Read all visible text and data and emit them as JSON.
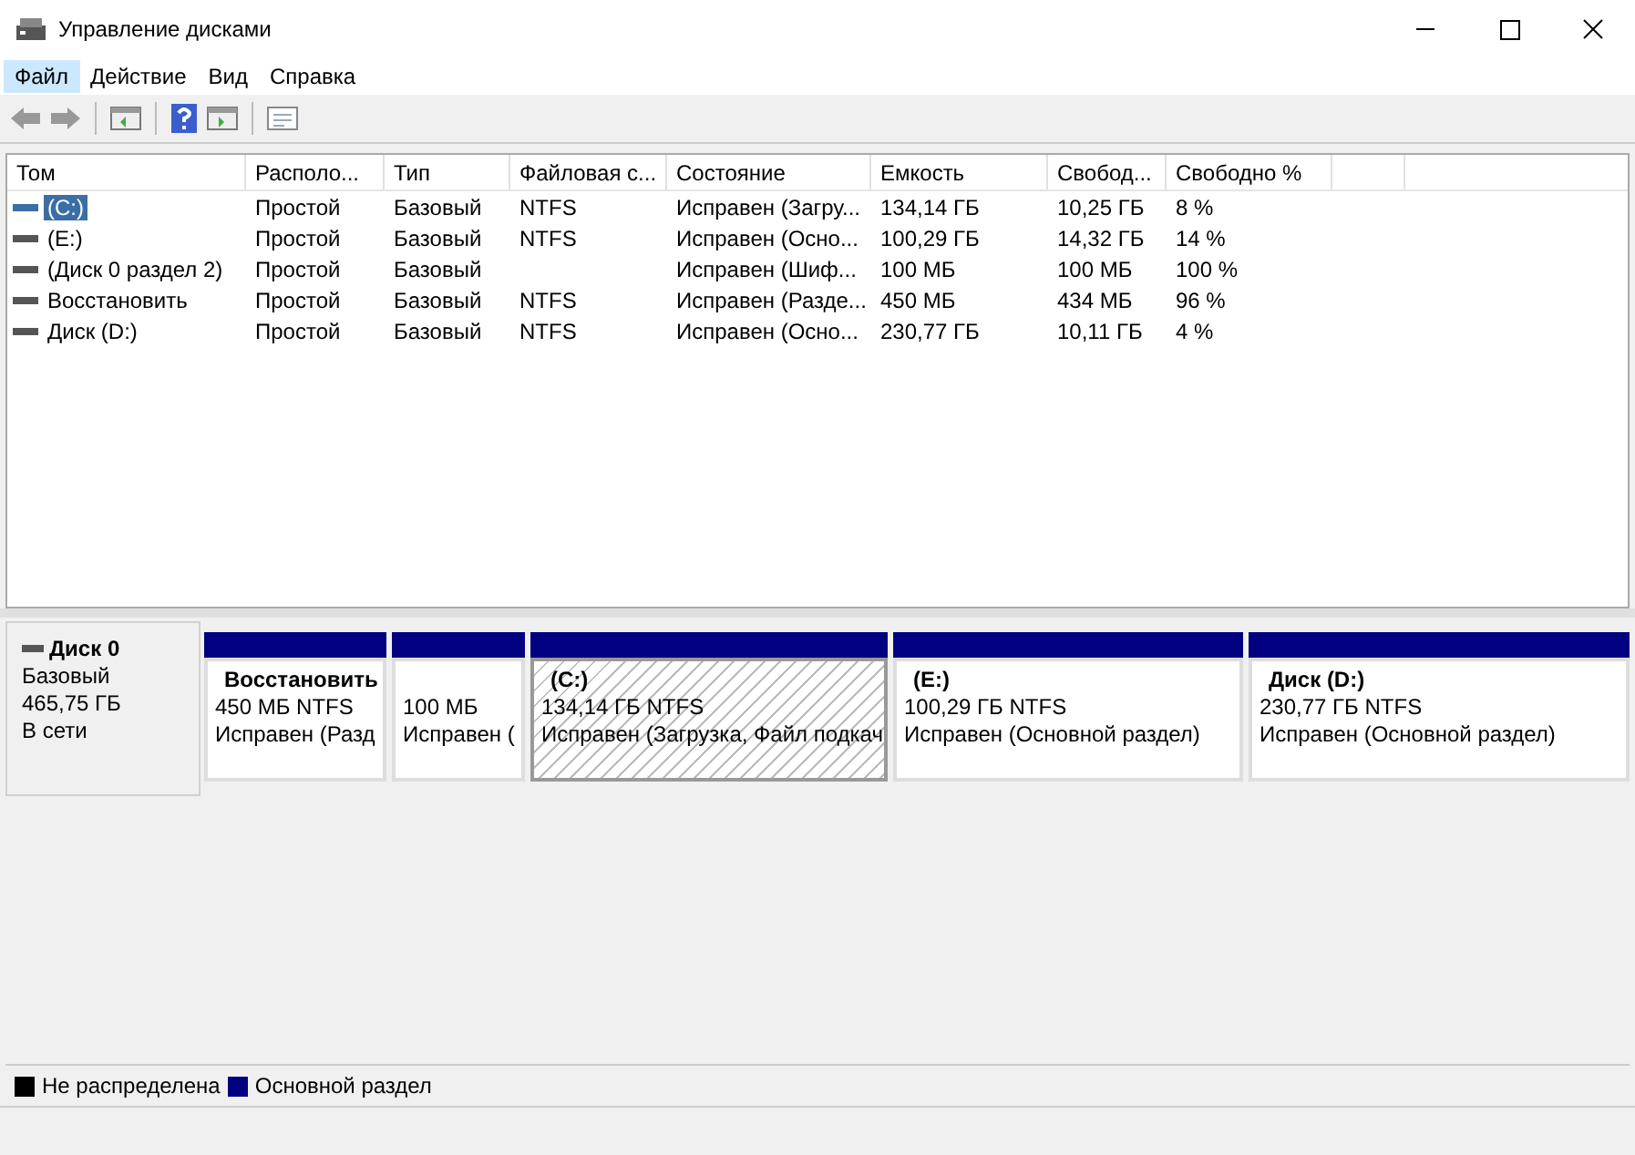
{
  "window": {
    "title": "Управление дисками"
  },
  "menu": [
    {
      "label": "Файл",
      "selected": true
    },
    {
      "label": "Действие",
      "selected": false
    },
    {
      "label": "Вид",
      "selected": false
    },
    {
      "label": "Справка",
      "selected": false
    }
  ],
  "table": {
    "columns": [
      "Том",
      "Располо...",
      "Тип",
      "Файловая с...",
      "Состояние",
      "Емкость",
      "Свобод...",
      "Свободно %"
    ],
    "rows": [
      {
        "selected": true,
        "cells": [
          "(C:)",
          "Простой",
          "Базовый",
          "NTFS",
          "Исправен (Загру...",
          "134,14 ГБ",
          "10,25 ГБ",
          "8 %"
        ]
      },
      {
        "selected": false,
        "cells": [
          " (E:)",
          "Простой",
          "Базовый",
          "NTFS",
          "Исправен (Осно...",
          "100,29 ГБ",
          "14,32 ГБ",
          "14 %"
        ]
      },
      {
        "selected": false,
        "cells": [
          "(Диск 0 раздел 2)",
          "Простой",
          "Базовый",
          "",
          "Исправен (Шиф...",
          "100 МБ",
          "100 МБ",
          "100 %"
        ]
      },
      {
        "selected": false,
        "cells": [
          "Восстановить",
          "Простой",
          "Базовый",
          "NTFS",
          "Исправен (Разде...",
          "450 МБ",
          "434 МБ",
          "96 %"
        ]
      },
      {
        "selected": false,
        "cells": [
          "Диск (D:)",
          "Простой",
          "Базовый",
          "NTFS",
          "Исправен (Осно...",
          "230,77 ГБ",
          "10,11 ГБ",
          "4 %"
        ]
      }
    ]
  },
  "disk": {
    "name": "Диск 0",
    "type": "Базовый",
    "size": "465,75 ГБ",
    "status": "В сети",
    "partitions": [
      {
        "selected": false,
        "label": "Восстановить",
        "size": "450 МБ NTFS",
        "status": "Исправен (Разд"
      },
      {
        "selected": false,
        "size": "100 МБ",
        "status": "Исправен ("
      },
      {
        "selected": true,
        "label": "(C:)",
        "size": "134,14 ГБ NTFS",
        "status": "Исправен (Загрузка, Файл подкач"
      },
      {
        "selected": false,
        "label": "(E:)",
        "size": "100,29 ГБ NTFS",
        "status": "Исправен (Основной раздел)"
      },
      {
        "selected": false,
        "label": "Диск  (D:)",
        "size": "230,77 ГБ NTFS",
        "status": "Исправен (Основной раздел)"
      }
    ]
  },
  "legend": [
    {
      "label": "Не распределена",
      "color": "#000000"
    },
    {
      "label": "Основной раздел",
      "color": "#000080"
    }
  ]
}
